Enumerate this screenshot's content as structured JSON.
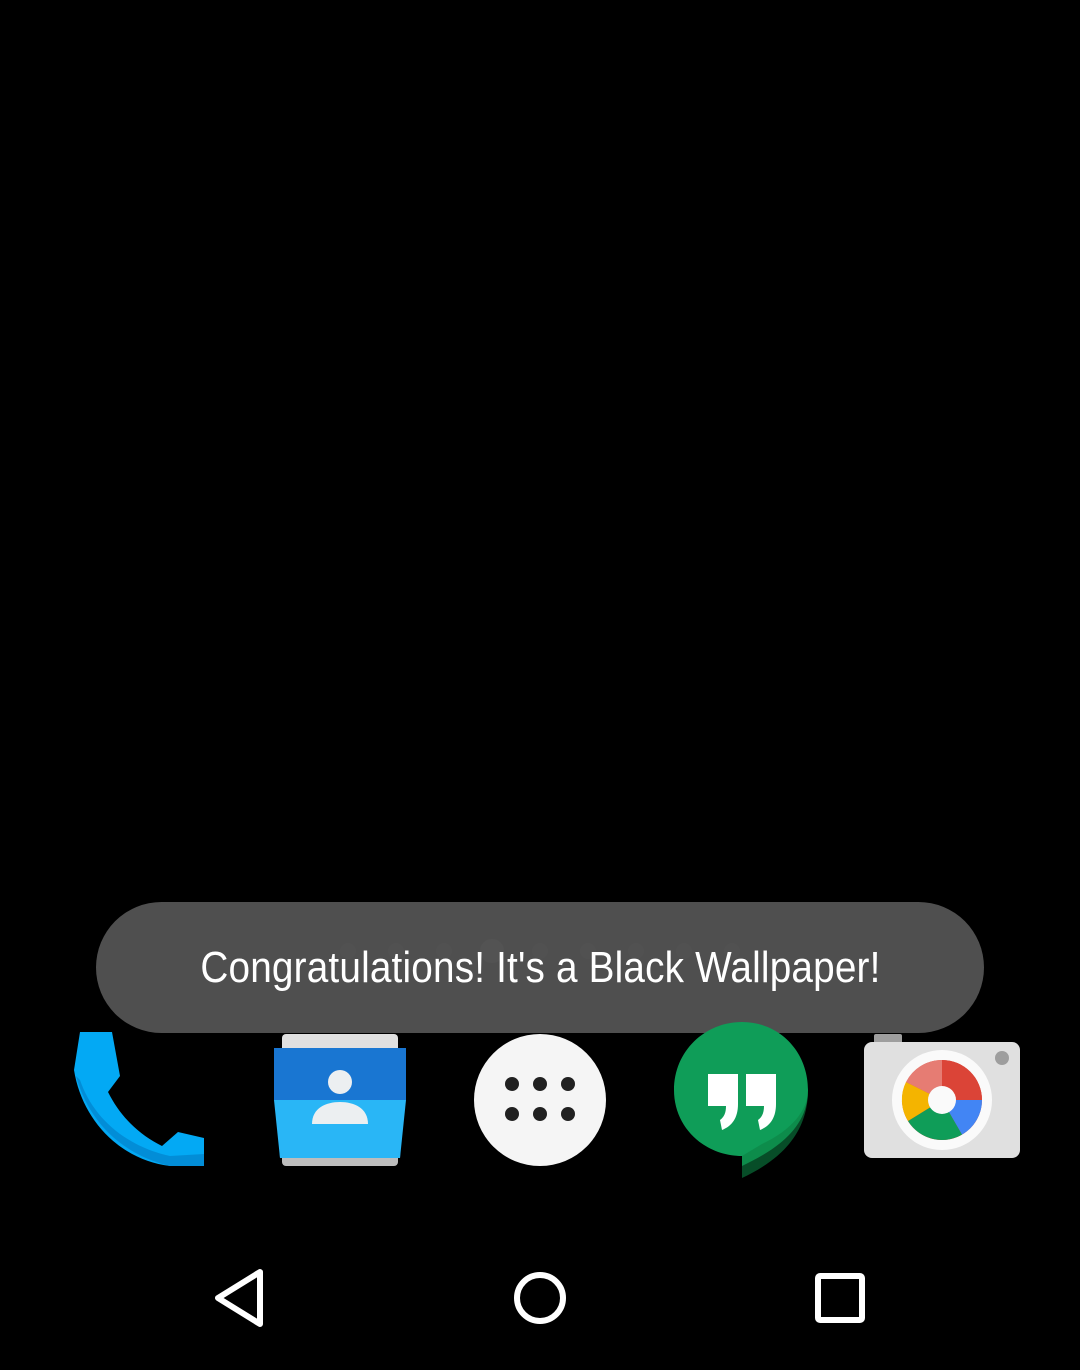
{
  "toast": {
    "message": "Congratulations! It's a Black Wallpaper!"
  },
  "page_indicator": {
    "page_count": 9,
    "current_page": 4
  },
  "dock": {
    "apps": [
      {
        "name": "Phone",
        "icon": "phone-icon",
        "color": "#03A9F4"
      },
      {
        "name": "Contacts",
        "icon": "contacts-icon",
        "color": "#1E88E5"
      },
      {
        "name": "All apps",
        "icon": "app-drawer-icon",
        "color": "#F5F5F5"
      },
      {
        "name": "Hangouts",
        "icon": "hangouts-icon",
        "color": "#0F9D58"
      },
      {
        "name": "Camera",
        "icon": "camera-icon",
        "color": "#E0E0E0"
      }
    ]
  },
  "nav_bar": {
    "buttons": [
      {
        "name": "Back",
        "icon": "back-icon"
      },
      {
        "name": "Home",
        "icon": "home-icon"
      },
      {
        "name": "Overview",
        "icon": "recents-icon"
      }
    ]
  }
}
